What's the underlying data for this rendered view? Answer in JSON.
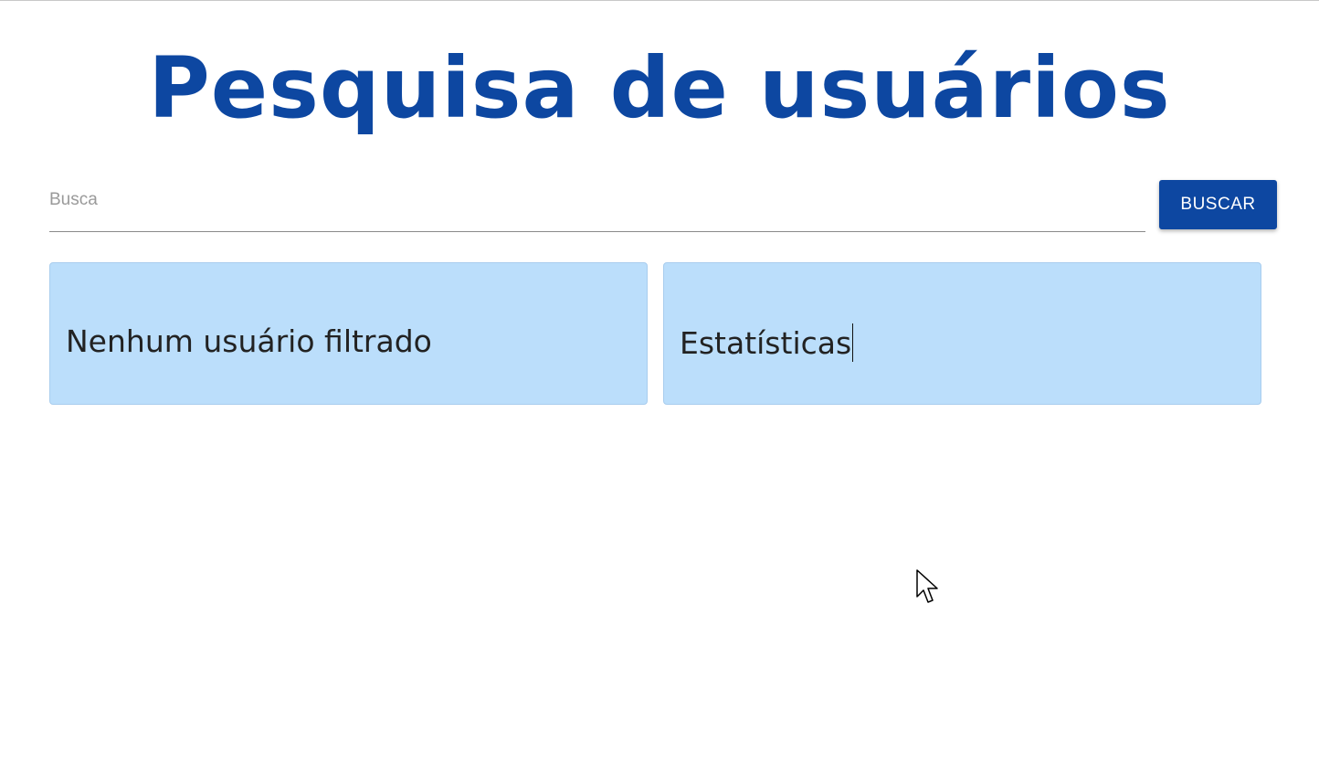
{
  "page": {
    "title": "Pesquisa de usuários"
  },
  "search": {
    "placeholder": "Busca",
    "value": "",
    "button_label": "BUSCAR"
  },
  "cards": {
    "users": {
      "text": "Nenhum usuário filtrado"
    },
    "stats": {
      "text": "Estatísticas"
    }
  },
  "colors": {
    "primary": "#0d47a1",
    "card_background": "#bbdefb",
    "text": "#222222",
    "placeholder": "#9a9a9a"
  },
  "icons": {
    "mouse_cursor": "arrow-pointer-icon"
  }
}
